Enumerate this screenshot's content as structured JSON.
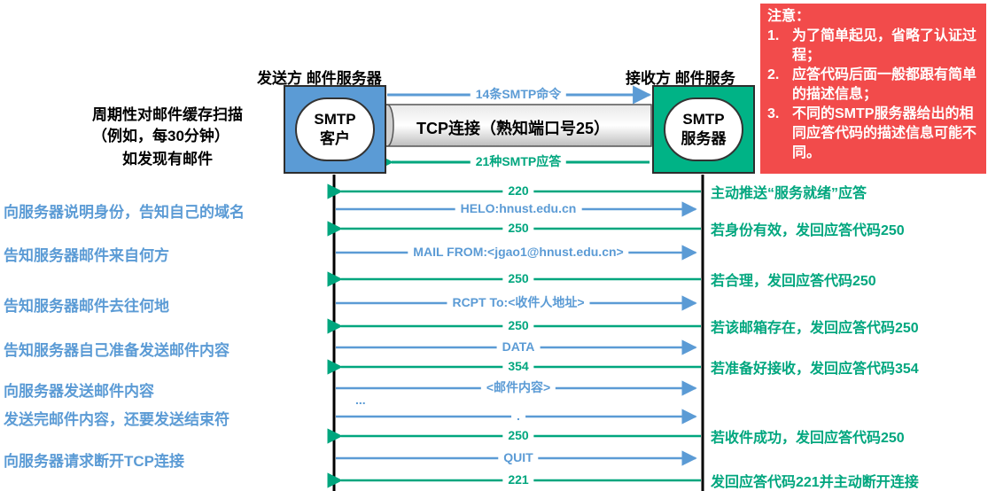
{
  "sender": {
    "title": "发送方 邮件服务器",
    "box_line1": "SMTP",
    "box_line2": "客户"
  },
  "receiver": {
    "title": "接收方 邮件服务",
    "box_line1": "SMTP",
    "box_line2": "服务器"
  },
  "scan_note": {
    "line1": "周期性对邮件缓存扫描",
    "line2": "（例如，每30分钟）",
    "line3": "如发现有邮件"
  },
  "tcp_pipe_label": "TCP连接（熟知端口号25）",
  "top_arrows": {
    "commands": "14条SMTP命令",
    "replies": "21种SMTP应答"
  },
  "note": {
    "title": "注意：",
    "items": [
      {
        "num": "1.",
        "text": "为了简单起见，省略了认证过程；"
      },
      {
        "num": "2.",
        "text": "应答代码后面一般都跟有简单的描述信息；"
      },
      {
        "num": "3.",
        "text": "不同的SMTP服务器给出的相同应答代码的描述信息可能不同。"
      }
    ]
  },
  "steps": [
    {
      "dir": "left",
      "label": "220",
      "note": "主动推送“服务就绪”应答"
    },
    {
      "dir": "right",
      "label": "HELO:hnust.edu.cn",
      "note": "向服务器说明身份，告知自己的域名"
    },
    {
      "dir": "left",
      "label": "250",
      "note": "若身份有效，发回应答代码250"
    },
    {
      "dir": "right",
      "label": "MAIL FROM:<jgao1@hnust.edu.cn>",
      "note": "告知服务器邮件来自何方"
    },
    {
      "dir": "left",
      "label": "250",
      "note": "若合理，发回应答代码250"
    },
    {
      "dir": "right",
      "label": "RCPT To:<收件人地址>",
      "note": "告知服务器邮件去往何地"
    },
    {
      "dir": "left",
      "label": "250",
      "note": "若该邮箱存在，发回应答代码250"
    },
    {
      "dir": "right",
      "label": "DATA",
      "note": "告知服务器自己准备发送邮件内容"
    },
    {
      "dir": "left",
      "label": "354",
      "note": "若准备好接收，发回应答代码354"
    },
    {
      "dir": "right",
      "label": "<邮件内容>",
      "note": "向服务器发送邮件内容"
    },
    {
      "dir": "right",
      "label": "...",
      "note": ""
    },
    {
      "dir": "right",
      "label": ".",
      "note": "发送完邮件内容，还要发送结束符"
    },
    {
      "dir": "left",
      "label": "250",
      "note": "若收件成功，发回应答代码250"
    },
    {
      "dir": "right",
      "label": "QUIT",
      "note": "向服务器请求断开TCP连接"
    },
    {
      "dir": "left",
      "label": "221",
      "note": "发回应答代码221并主动断开连接"
    }
  ],
  "colors": {
    "client_box": "#5b9bd5",
    "server_box": "#00b386",
    "reply": "#00a67e",
    "command": "#5b9bd5",
    "note_bg": "#f24b4b"
  }
}
